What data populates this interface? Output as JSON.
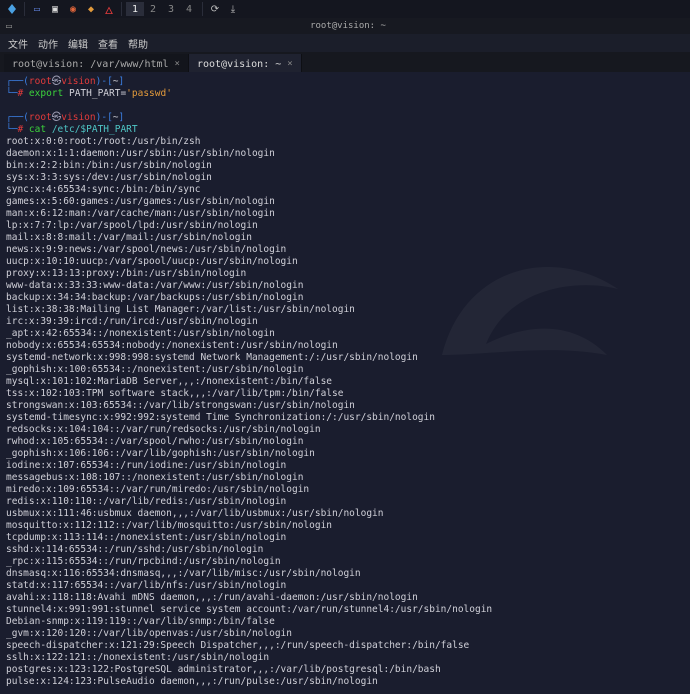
{
  "taskbar": {
    "workspaces": [
      "1",
      "2",
      "3",
      "4"
    ],
    "active_workspace": 0
  },
  "window": {
    "title": "root@vision: ~"
  },
  "menu": {
    "items": [
      "文件",
      "动作",
      "编辑",
      "查看",
      "帮助"
    ]
  },
  "tabs": {
    "items": [
      {
        "label": "root@vision: /var/www/html"
      },
      {
        "label": "root@vision: ~"
      }
    ],
    "active": 1
  },
  "prompt": {
    "user": "root",
    "at": "㉿",
    "host": "vision",
    "path": "~",
    "cmd1_kw": "export",
    "cmd1_rest": " PATH_PART=",
    "cmd1_str": "'passwd'",
    "cmd2_cmd": "cat",
    "cmd2_arg": " /etc/$PATH_PART"
  },
  "passwd": [
    "root:x:0:0:root:/root:/usr/bin/zsh",
    "daemon:x:1:1:daemon:/usr/sbin:/usr/sbin/nologin",
    "bin:x:2:2:bin:/bin:/usr/sbin/nologin",
    "sys:x:3:3:sys:/dev:/usr/sbin/nologin",
    "sync:x:4:65534:sync:/bin:/bin/sync",
    "games:x:5:60:games:/usr/games:/usr/sbin/nologin",
    "man:x:6:12:man:/var/cache/man:/usr/sbin/nologin",
    "lp:x:7:7:lp:/var/spool/lpd:/usr/sbin/nologin",
    "mail:x:8:8:mail:/var/mail:/usr/sbin/nologin",
    "news:x:9:9:news:/var/spool/news:/usr/sbin/nologin",
    "uucp:x:10:10:uucp:/var/spool/uucp:/usr/sbin/nologin",
    "proxy:x:13:13:proxy:/bin:/usr/sbin/nologin",
    "www-data:x:33:33:www-data:/var/www:/usr/sbin/nologin",
    "backup:x:34:34:backup:/var/backups:/usr/sbin/nologin",
    "list:x:38:38:Mailing List Manager:/var/list:/usr/sbin/nologin",
    "irc:x:39:39:ircd:/run/ircd:/usr/sbin/nologin",
    "_apt:x:42:65534::/nonexistent:/usr/sbin/nologin",
    "nobody:x:65534:65534:nobody:/nonexistent:/usr/sbin/nologin",
    "systemd-network:x:998:998:systemd Network Management:/:/usr/sbin/nologin",
    "_gophish:x:100:65534::/nonexistent:/usr/sbin/nologin",
    "mysql:x:101:102:MariaDB Server,,,:/nonexistent:/bin/false",
    "tss:x:102:103:TPM software stack,,,:/var/lib/tpm:/bin/false",
    "strongswan:x:103:65534::/var/lib/strongswan:/usr/sbin/nologin",
    "systemd-timesync:x:992:992:systemd Time Synchronization:/:/usr/sbin/nologin",
    "redsocks:x:104:104::/var/run/redsocks:/usr/sbin/nologin",
    "rwhod:x:105:65534::/var/spool/rwho:/usr/sbin/nologin",
    "_gophish:x:106:106::/var/lib/gophish:/usr/sbin/nologin",
    "iodine:x:107:65534::/run/iodine:/usr/sbin/nologin",
    "messagebus:x:108:107::/nonexistent:/usr/sbin/nologin",
    "miredo:x:109:65534::/var/run/miredo:/usr/sbin/nologin",
    "redis:x:110:110::/var/lib/redis:/usr/sbin/nologin",
    "usbmux:x:111:46:usbmux daemon,,,:/var/lib/usbmux:/usr/sbin/nologin",
    "mosquitto:x:112:112::/var/lib/mosquitto:/usr/sbin/nologin",
    "tcpdump:x:113:114::/nonexistent:/usr/sbin/nologin",
    "sshd:x:114:65534::/run/sshd:/usr/sbin/nologin",
    "_rpc:x:115:65534::/run/rpcbind:/usr/sbin/nologin",
    "dnsmasq:x:116:65534:dnsmasq,,,:/var/lib/misc:/usr/sbin/nologin",
    "statd:x:117:65534::/var/lib/nfs:/usr/sbin/nologin",
    "avahi:x:118:118:Avahi mDNS daemon,,,:/run/avahi-daemon:/usr/sbin/nologin",
    "stunnel4:x:991:991:stunnel service system account:/var/run/stunnel4:/usr/sbin/nologin",
    "Debian-snmp:x:119:119::/var/lib/snmp:/bin/false",
    "_gvm:x:120:120::/var/lib/openvas:/usr/sbin/nologin",
    "speech-dispatcher:x:121:29:Speech Dispatcher,,,:/run/speech-dispatcher:/bin/false",
    "sslh:x:122:121::/nonexistent:/usr/sbin/nologin",
    "postgres:x:123:122:PostgreSQL administrator,,,:/var/lib/postgresql:/bin/bash",
    "pulse:x:124:123:PulseAudio daemon,,,:/run/pulse:/usr/sbin/nologin"
  ]
}
